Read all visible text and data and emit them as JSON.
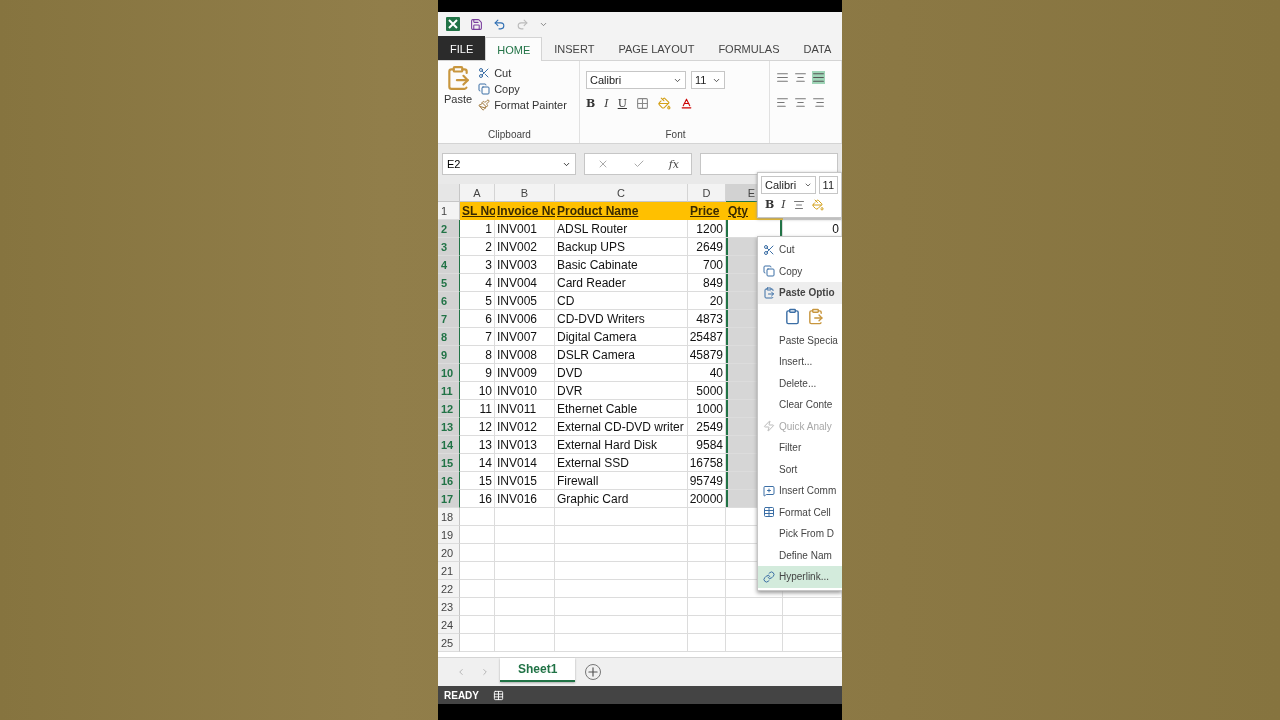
{
  "ribbon": {
    "tabs": [
      {
        "label": "FILE",
        "kind": "file",
        "selected": false
      },
      {
        "label": "HOME",
        "kind": "tab",
        "selected": true
      },
      {
        "label": "INSERT",
        "kind": "tab",
        "selected": false
      },
      {
        "label": "PAGE LAYOUT",
        "kind": "tab",
        "selected": false
      },
      {
        "label": "FORMULAS",
        "kind": "tab",
        "selected": false
      },
      {
        "label": "DATA",
        "kind": "tab",
        "selected": false
      }
    ],
    "clipboard": {
      "paste": "Paste",
      "cut": "Cut",
      "copy": "Copy",
      "format_painter": "Format Painter",
      "label": "Clipboard"
    },
    "font": {
      "name": "Calibri",
      "size": "11",
      "bold": "B",
      "italic": "I",
      "underline": "U",
      "label": "Font"
    }
  },
  "formula_bar": {
    "name_box": "E2",
    "fx": "fx"
  },
  "columns": [
    {
      "label": "A",
      "selected": false
    },
    {
      "label": "B",
      "selected": false
    },
    {
      "label": "C",
      "selected": false
    },
    {
      "label": "D",
      "selected": false
    },
    {
      "label": "E",
      "selected": true
    }
  ],
  "rows": [
    {
      "number": "1",
      "selected": false,
      "cells": [
        "SL No",
        "Invoice Nc",
        "Product Name",
        "Price",
        "Qty",
        ""
      ]
    },
    {
      "number": "2",
      "selected": true,
      "cells": [
        "1",
        "INV001",
        "ADSL Router",
        "1200",
        "",
        "0"
      ]
    },
    {
      "number": "3",
      "selected": true,
      "cells": [
        "2",
        "INV002",
        "Backup UPS",
        "2649",
        "",
        ""
      ]
    },
    {
      "number": "4",
      "selected": true,
      "cells": [
        "3",
        "INV003",
        "Basic Cabinate",
        "700",
        "",
        ""
      ]
    },
    {
      "number": "5",
      "selected": true,
      "cells": [
        "4",
        "INV004",
        "Card Reader",
        "849",
        "",
        ""
      ]
    },
    {
      "number": "6",
      "selected": true,
      "cells": [
        "5",
        "INV005",
        "CD",
        "20",
        "",
        ""
      ]
    },
    {
      "number": "7",
      "selected": true,
      "cells": [
        "6",
        "INV006",
        "CD-DVD Writers",
        "4873",
        "",
        ""
      ]
    },
    {
      "number": "8",
      "selected": true,
      "cells": [
        "7",
        "INV007",
        "Digital Camera",
        "25487",
        "",
        ""
      ]
    },
    {
      "number": "9",
      "selected": true,
      "cells": [
        "8",
        "INV008",
        "DSLR Camera",
        "45879",
        "",
        ""
      ]
    },
    {
      "number": "10",
      "selected": true,
      "cells": [
        "9",
        "INV009",
        "DVD",
        "40",
        "",
        ""
      ]
    },
    {
      "number": "11",
      "selected": true,
      "cells": [
        "10",
        "INV010",
        "DVR",
        "5000",
        "",
        ""
      ]
    },
    {
      "number": "12",
      "selected": true,
      "cells": [
        "11",
        "INV011",
        "Ethernet Cable",
        "1000",
        "",
        ""
      ]
    },
    {
      "number": "13",
      "selected": true,
      "cells": [
        "12",
        "INV012",
        "External CD-DVD writer",
        "2549",
        "",
        ""
      ]
    },
    {
      "number": "14",
      "selected": true,
      "cells": [
        "13",
        "INV013",
        "External Hard Disk",
        "9584",
        "",
        ""
      ]
    },
    {
      "number": "15",
      "selected": true,
      "cells": [
        "14",
        "INV014",
        "External SSD",
        "16758",
        "",
        ""
      ]
    },
    {
      "number": "16",
      "selected": true,
      "cells": [
        "15",
        "INV015",
        "Firewall",
        "95749",
        "",
        ""
      ]
    },
    {
      "number": "17",
      "selected": true,
      "cells": [
        "16",
        "INV016",
        "Graphic Card",
        "20000",
        "",
        ""
      ]
    },
    {
      "number": "18",
      "selected": false,
      "cells": [
        "",
        "",
        "",
        "",
        "",
        ""
      ]
    },
    {
      "number": "19",
      "selected": false,
      "cells": [
        "",
        "",
        "",
        "",
        "",
        ""
      ]
    },
    {
      "number": "20",
      "selected": false,
      "cells": [
        "",
        "",
        "",
        "",
        "",
        ""
      ]
    },
    {
      "number": "21",
      "selected": false,
      "cells": [
        "",
        "",
        "",
        "",
        "",
        ""
      ]
    },
    {
      "number": "22",
      "selected": false,
      "cells": [
        "",
        "",
        "",
        "",
        "",
        ""
      ]
    },
    {
      "number": "23",
      "selected": false,
      "cells": [
        "",
        "",
        "",
        "",
        "",
        ""
      ]
    },
    {
      "number": "24",
      "selected": false,
      "cells": [
        "",
        "",
        "",
        "",
        "",
        ""
      ]
    },
    {
      "number": "25",
      "selected": false,
      "cells": [
        "",
        "",
        "",
        "",
        "",
        ""
      ]
    }
  ],
  "mini_toolbar": {
    "font": "Calibri",
    "size": "11",
    "bold": "B",
    "italic": "I"
  },
  "context_menu": [
    {
      "label": "Cut",
      "kind": "cut",
      "selected": false,
      "disabled": false
    },
    {
      "label": "Copy",
      "kind": "copy",
      "selected": false,
      "disabled": false
    },
    {
      "label": "Paste Optio",
      "kind": "header",
      "selected": false,
      "disabled": false
    },
    {
      "kind": "pastebuttons"
    },
    {
      "label": "Paste Specia",
      "kind": "plain",
      "selected": false,
      "disabled": false
    },
    {
      "label": "Insert...",
      "kind": "plain",
      "selected": false,
      "disabled": false
    },
    {
      "label": "Delete...",
      "kind": "plain",
      "selected": false,
      "disabled": false
    },
    {
      "label": "Clear Conte",
      "kind": "plain",
      "selected": false,
      "disabled": false
    },
    {
      "label": "Quick Analy",
      "kind": "analysis",
      "selected": false,
      "disabled": true
    },
    {
      "label": "Filter",
      "kind": "plain",
      "selected": false,
      "disabled": false
    },
    {
      "label": "Sort",
      "kind": "plain",
      "selected": false,
      "disabled": false
    },
    {
      "label": "Insert Comm",
      "kind": "comment",
      "selected": false,
      "disabled": false
    },
    {
      "label": "Format Cell",
      "kind": "format",
      "selected": false,
      "disabled": false
    },
    {
      "label": "Pick From D",
      "kind": "plain",
      "selected": false,
      "disabled": false
    },
    {
      "label": "Define Nam",
      "kind": "plain",
      "selected": false,
      "disabled": false
    },
    {
      "label": "Hyperlink...",
      "kind": "link",
      "selected": true,
      "disabled": false
    }
  ],
  "sheets": [
    {
      "label": "Sheet1",
      "selected": true
    }
  ],
  "status_bar": {
    "text": "READY"
  }
}
